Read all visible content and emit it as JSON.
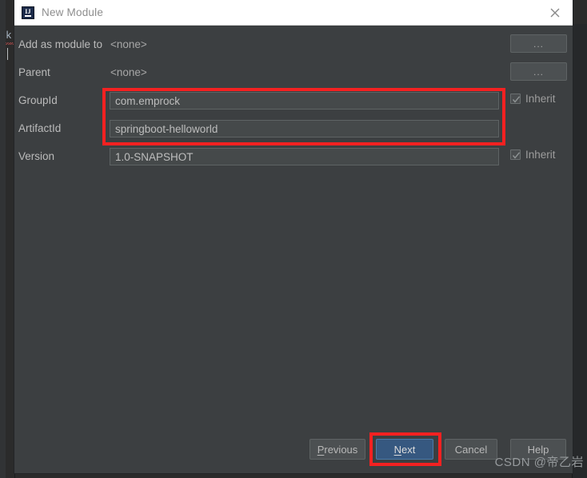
{
  "window": {
    "title": "New Module",
    "icon": "intellij-idea-icon",
    "close_label": "×"
  },
  "background": {
    "code_fragment": "k"
  },
  "form": {
    "rows": [
      {
        "label": "Add as module to",
        "kind": "static",
        "value": "<none>",
        "browse_button": "...",
        "name": "add-as-module-to"
      },
      {
        "label": "Parent",
        "kind": "static",
        "value": "<none>",
        "browse_button": "...",
        "name": "parent"
      },
      {
        "label": "GroupId",
        "kind": "input",
        "value": "com.emprock",
        "inherit_label": "Inherit",
        "inherit_checked": true,
        "name": "group-id"
      },
      {
        "label": "ArtifactId",
        "kind": "input",
        "value": "springboot-helloworld",
        "name": "artifact-id"
      },
      {
        "label": "Version",
        "kind": "input",
        "value": "1.0-SNAPSHOT",
        "inherit_label": "Inherit",
        "inherit_checked": true,
        "name": "version"
      }
    ]
  },
  "footer": {
    "previous": "Previous",
    "previous_mnemonic": "P",
    "next": "Next",
    "next_mnemonic": "N",
    "cancel": "Cancel",
    "help": "Help"
  },
  "watermark": {
    "text": "CSDN @帝乙岩"
  },
  "colors": {
    "dialog_bg": "#3c3f41",
    "input_bg": "#45494a",
    "primary_button": "#365880",
    "annotation_red": "#f42121",
    "titlebar_bg": "#ffffff"
  }
}
